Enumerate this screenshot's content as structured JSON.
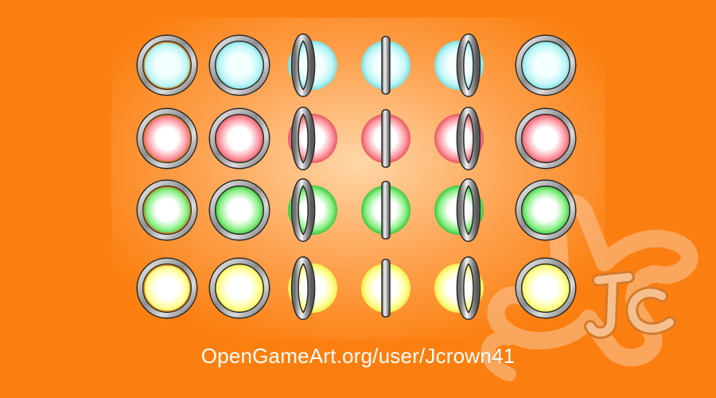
{
  "credit": "OpenGameArt.org/user/Jcrown41",
  "colors": {
    "background": "#fb7f10",
    "panel_glow": "#ffd7a8",
    "watermark": "#f7b98d"
  },
  "watermark": {
    "text": "JC",
    "kind": "logo"
  },
  "rows": [
    {
      "color": "cyan",
      "inner": "#f4ffff",
      "mid": "#bff6f7",
      "outer": "#7fdede"
    },
    {
      "color": "red",
      "inner": "#ffffff",
      "mid": "#fb9aa4",
      "outer": "#e9565f"
    },
    {
      "color": "green",
      "inner": "#ffffff",
      "mid": "#8ef08a",
      "outer": "#39c93a"
    },
    {
      "color": "yellow",
      "inner": "#ffffff",
      "mid": "#ffff9a",
      "outer": "#f0ee4a"
    }
  ],
  "frames": [
    {
      "name": "full-front",
      "squeeze": 1.0,
      "ring_side": "full"
    },
    {
      "name": "full-rim",
      "squeeze": 1.0,
      "ring_side": "full"
    },
    {
      "name": "turn-left",
      "squeeze": 0.55,
      "ring_side": "left"
    },
    {
      "name": "edge-on",
      "squeeze": 0.0,
      "ring_side": "center"
    },
    {
      "name": "turn-right",
      "squeeze": 0.55,
      "ring_side": "right"
    },
    {
      "name": "full-back",
      "squeeze": 1.0,
      "ring_side": "full"
    }
  ]
}
